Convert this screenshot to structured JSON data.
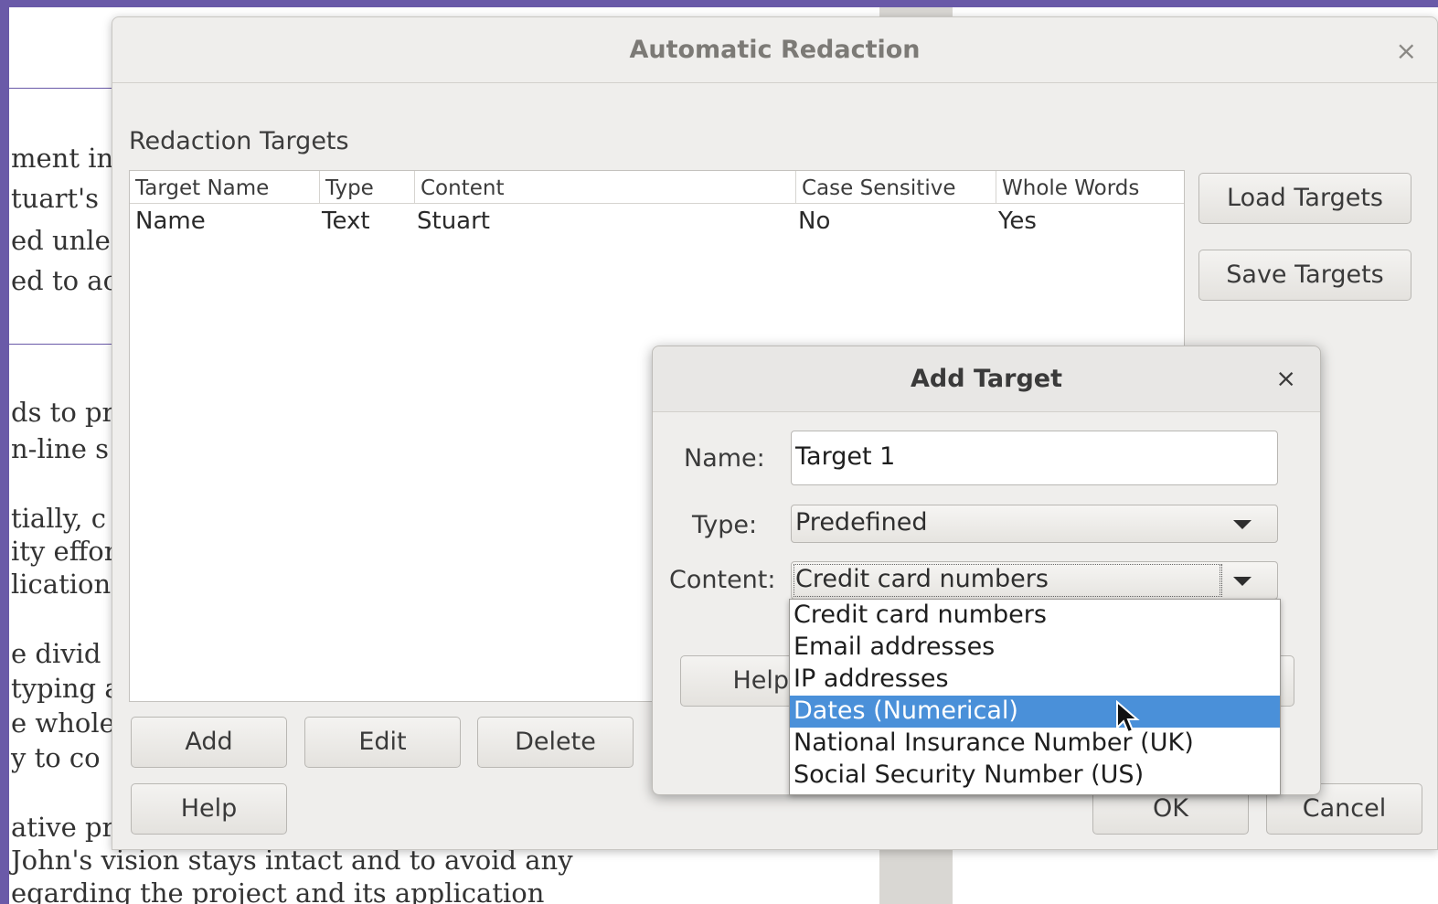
{
  "background_document": {
    "lines": [
      "ment in",
      "tuart's",
      "ed unle",
      "ed to ac",
      "ds to pr",
      "n-line s",
      "tially, c",
      "ity effor",
      "lication",
      "e divid",
      "typing a",
      "e whole",
      "y to co",
      "ative pr",
      "John's vision stays intact and to avoid any",
      "egarding the project and its application"
    ]
  },
  "main_dialog": {
    "title": "Automatic Redaction",
    "close_glyph": "×",
    "section_label": "Redaction Targets",
    "columns": [
      "Target Name",
      "Type",
      "Content",
      "Case Sensitive",
      "Whole Words"
    ],
    "rows": [
      {
        "target_name": "Name",
        "type": "Text",
        "content": "Stuart",
        "case_sensitive": "No",
        "whole_words": "Yes"
      }
    ],
    "buttons": {
      "load_targets": "Load Targets",
      "save_targets": "Save Targets",
      "add": "Add",
      "edit": "Edit",
      "delete": "Delete",
      "help": "Help",
      "ok": "OK",
      "cancel": "Cancel"
    }
  },
  "add_target_dialog": {
    "title": "Add Target",
    "close_glyph": "×",
    "name_label": "Name:",
    "name_value": "Target 1",
    "type_label": "Type:",
    "type_value": "Predefined",
    "content_label": "Content:",
    "content_value": "Credit card numbers",
    "help_button": "Help",
    "dropdown_options": [
      "Credit card numbers",
      "Email addresses",
      "IP addresses",
      "Dates (Numerical)",
      "National Insurance Number (UK)",
      "Social Security Number (US)"
    ],
    "highlighted_option_index": 3
  },
  "colors": {
    "desktop": "#6a5aa8",
    "dialog_bg": "#efeeec",
    "highlight": "#4a90d9"
  }
}
